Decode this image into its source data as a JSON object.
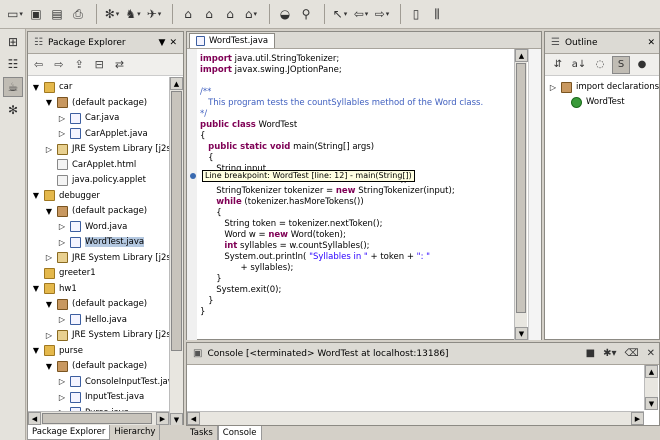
{
  "toolbar": {
    "buttons": [
      "new-wizard-icon",
      "save-icon",
      "save-all-icon",
      "print-icon",
      "debug-icon",
      "run-icon",
      "external-tools-icon",
      "new-java-project-icon",
      "new-package-icon",
      "new-class-icon",
      "new-interface-icon",
      "open-type-icon",
      "search-icon",
      "back-icon",
      "forward-icon",
      "prev-annotation-icon",
      "next-annotation-icon",
      "perspective-icon"
    ]
  },
  "package_explorer": {
    "title": "Package Explorer",
    "tree": [
      {
        "indent": 0,
        "twisty": "▼",
        "icon": "folder",
        "label": "car"
      },
      {
        "indent": 1,
        "twisty": "▼",
        "icon": "pkg",
        "label": "(default package)"
      },
      {
        "indent": 2,
        "twisty": "▷",
        "icon": "java",
        "label": "Car.java"
      },
      {
        "indent": 2,
        "twisty": "▷",
        "icon": "java",
        "label": "CarApplet.java"
      },
      {
        "indent": 1,
        "twisty": "▷",
        "icon": "lib",
        "label": "JRE System Library [j2sd"
      },
      {
        "indent": 1,
        "twisty": "",
        "icon": "html",
        "label": "CarApplet.html"
      },
      {
        "indent": 1,
        "twisty": "",
        "icon": "html",
        "label": "java.policy.applet"
      },
      {
        "indent": 0,
        "twisty": "▼",
        "icon": "folder",
        "label": "debugger"
      },
      {
        "indent": 1,
        "twisty": "▼",
        "icon": "pkg",
        "label": "(default package)"
      },
      {
        "indent": 2,
        "twisty": "▷",
        "icon": "java",
        "label": "Word.java"
      },
      {
        "indent": 2,
        "twisty": "▷",
        "icon": "java",
        "label": "WordTest.java",
        "selected": true
      },
      {
        "indent": 1,
        "twisty": "▷",
        "icon": "lib",
        "label": "JRE System Library [j2sd"
      },
      {
        "indent": 0,
        "twisty": "",
        "icon": "folder",
        "label": "greeter1"
      },
      {
        "indent": 0,
        "twisty": "▼",
        "icon": "folder",
        "label": "hw1"
      },
      {
        "indent": 1,
        "twisty": "▼",
        "icon": "pkg",
        "label": "(default package)"
      },
      {
        "indent": 2,
        "twisty": "▷",
        "icon": "java",
        "label": "Hello.java"
      },
      {
        "indent": 1,
        "twisty": "▷",
        "icon": "lib",
        "label": "JRE System Library [j2sd"
      },
      {
        "indent": 0,
        "twisty": "▼",
        "icon": "folder",
        "label": "purse"
      },
      {
        "indent": 1,
        "twisty": "▼",
        "icon": "pkg",
        "label": "(default package)"
      },
      {
        "indent": 2,
        "twisty": "▷",
        "icon": "java",
        "label": "ConsoleInputTest.java"
      },
      {
        "indent": 2,
        "twisty": "▷",
        "icon": "java",
        "label": "InputTest.java"
      },
      {
        "indent": 2,
        "twisty": "▷",
        "icon": "java",
        "label": "Purse.java"
      }
    ],
    "bottom_tabs": [
      "Package Explorer",
      "Hierarchy"
    ]
  },
  "editor": {
    "tab": "WordTest.java",
    "lines": [
      [
        [
          "kw",
          "import"
        ],
        [
          "",
          "java.util.StringTokenizer;"
        ]
      ],
      [
        [
          "kw",
          "import"
        ],
        [
          "",
          "javax.swing.JOptionPane;"
        ]
      ],
      [],
      [
        [
          "cm",
          "/**"
        ]
      ],
      [
        [
          "cm",
          "   This program tests the countSyllables method of the Word class."
        ]
      ],
      [
        [
          "cm",
          "*/"
        ]
      ],
      [
        [
          "kw",
          "public class"
        ],
        [
          "",
          "WordTest"
        ]
      ],
      [
        [
          "",
          "{"
        ]
      ],
      [
        [
          "",
          "   "
        ],
        [
          "kw",
          "public static void"
        ],
        [
          "",
          "main(String[] args)"
        ]
      ],
      [
        [
          "",
          "   {"
        ]
      ],
      [
        [
          "",
          "      String input"
        ]
      ],
      [
        [
          "",
          "                                                                tence\");"
        ]
      ],
      [
        [
          "",
          "      StringTokenizer tokenizer = "
        ],
        [
          "kw",
          "new"
        ],
        [
          "",
          "StringTokenizer(input);"
        ]
      ],
      [
        [
          "",
          "      "
        ],
        [
          "kw",
          "while"
        ],
        [
          "",
          "(tokenizer.hasMoreTokens())"
        ]
      ],
      [
        [
          "",
          "      {"
        ]
      ],
      [
        [
          "",
          "         String token = tokenizer.nextToken();"
        ]
      ],
      [
        [
          "",
          "         Word w = "
        ],
        [
          "kw",
          "new"
        ],
        [
          "",
          "Word(token);"
        ]
      ],
      [
        [
          "",
          "         "
        ],
        [
          "kw",
          "int"
        ],
        [
          "",
          "syllables = w.countSyllables();"
        ]
      ],
      [
        [
          "",
          "         System.out.println("
        ],
        [
          "st",
          "\"Syllables in \""
        ],
        [
          "",
          "+ token + "
        ],
        [
          "st",
          "\": \""
        ]
      ],
      [
        [
          "",
          "               + syllables);"
        ]
      ],
      [
        [
          "",
          "      }"
        ]
      ],
      [
        [
          "",
          "      System.exit(0);"
        ]
      ],
      [
        [
          "",
          "   }"
        ]
      ],
      [
        [
          "",
          "}"
        ]
      ]
    ],
    "tooltip": "Line breakpoint: WordTest [line: 12] - main(String[])"
  },
  "outline": {
    "title": "Outline",
    "items": [
      {
        "twisty": "▷",
        "icon": "import-declarations-icon",
        "label": "import declarations",
        "indent": 0
      },
      {
        "twisty": "",
        "icon": "class-icon",
        "label": "WordTest",
        "indent": 1
      }
    ]
  },
  "console": {
    "title": "Console [<terminated> WordTest at localhost:13186]"
  },
  "bottom_tabs": [
    "Tasks",
    "Console"
  ]
}
